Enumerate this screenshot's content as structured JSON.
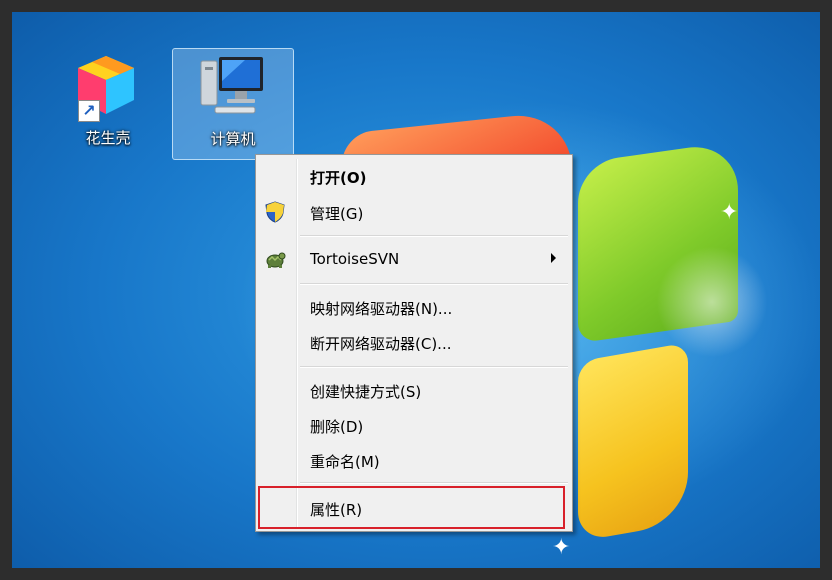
{
  "desktop": {
    "icons": [
      {
        "label": "花生壳",
        "icon": "peanut-shell-app-icon",
        "shortcut": true
      },
      {
        "label": "计算机",
        "icon": "computer-icon",
        "selected": true
      }
    ]
  },
  "context_menu": {
    "items": [
      {
        "label": "打开(O)",
        "bold": true
      },
      {
        "label": "管理(G)",
        "icon": "uac-shield-icon"
      },
      {
        "label": "TortoiseSVN",
        "icon": "tortoisesvn-icon",
        "submenu": true
      },
      {
        "label": "映射网络驱动器(N)..."
      },
      {
        "label": "断开网络驱动器(C)..."
      },
      {
        "label": "创建快捷方式(S)"
      },
      {
        "label": "删除(D)"
      },
      {
        "label": "重命名(M)"
      },
      {
        "label": "属性(R)",
        "highlighted": true
      }
    ]
  },
  "colors": {
    "highlight_box": "#d8202a",
    "menu_background": "#f0f0f0"
  }
}
